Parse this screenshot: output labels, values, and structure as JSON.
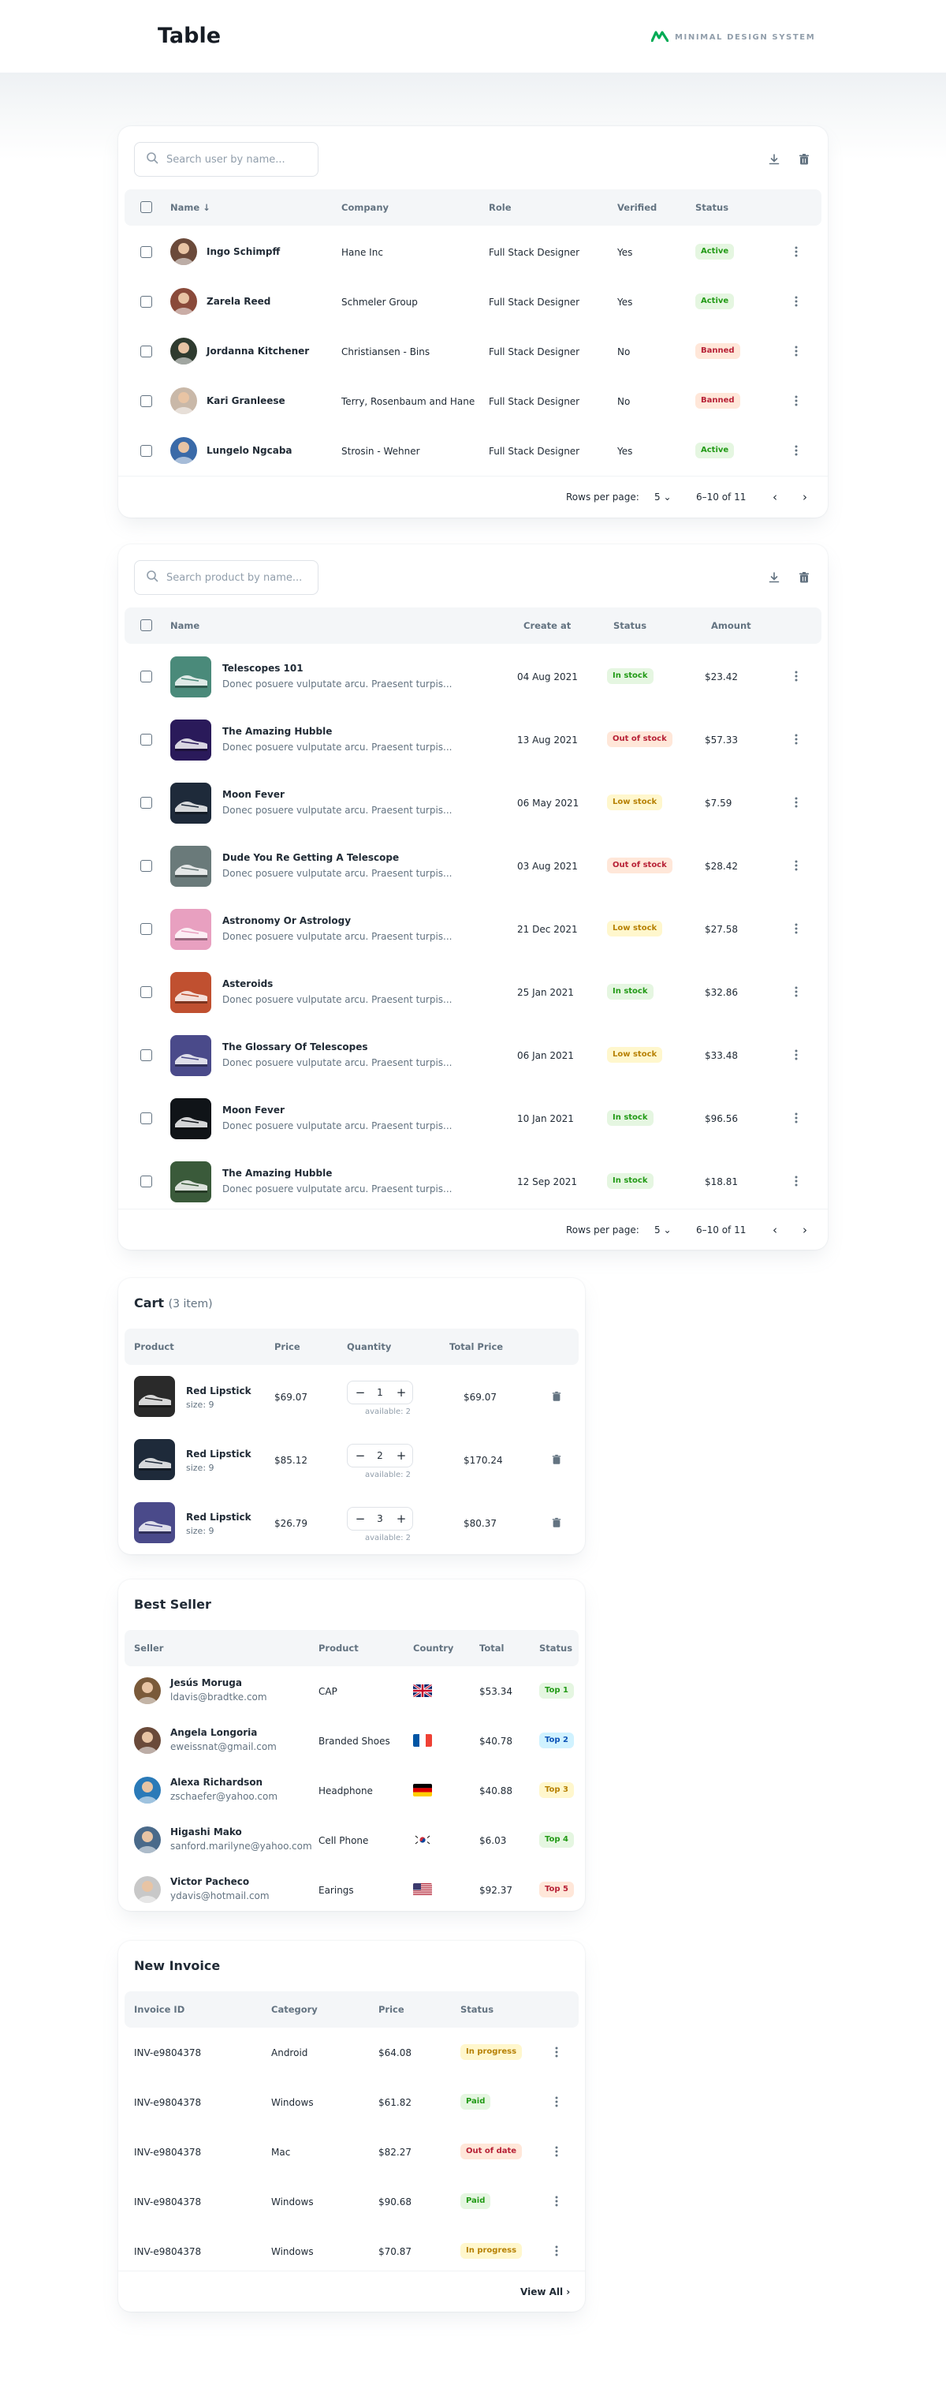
{
  "header": {
    "title": "Table",
    "brand": "MINIMAL DESIGN SYSTEM"
  },
  "users": {
    "search_placeholder": "Search user by name...",
    "columns": [
      "Name",
      "Company",
      "Role",
      "Verified",
      "Status"
    ],
    "rows": [
      {
        "name": "Ingo Schimpff",
        "company": "Hane Inc",
        "role": "Full Stack Designer",
        "verified": "Yes",
        "status": "Active",
        "avatar_color": "#6b4a3a"
      },
      {
        "name": "Zarela Reed",
        "company": "Schmeler Group",
        "role": "Full Stack Designer",
        "verified": "Yes",
        "status": "Active",
        "avatar_color": "#8a4a3a"
      },
      {
        "name": "Jordanna Kitchener",
        "company": "Christiansen - Bins",
        "role": "Full Stack Designer",
        "verified": "No",
        "status": "Banned",
        "avatar_color": "#2f3b2f"
      },
      {
        "name": "Kari Granleese",
        "company": "Terry, Rosenbaum and Hane",
        "role": "Full Stack Designer",
        "verified": "No",
        "status": "Banned",
        "avatar_color": "#c9b8a8"
      },
      {
        "name": "Lungelo Ngcaba",
        "company": "Strosin - Wehner",
        "role": "Full Stack Designer",
        "verified": "Yes",
        "status": "Active",
        "avatar_color": "#3a6aa8"
      }
    ],
    "pagination": {
      "rows_label": "Rows per page:",
      "rows_value": "5",
      "range": "6–10 of 11"
    }
  },
  "products": {
    "search_placeholder": "Search product by name...",
    "columns": [
      "Name",
      "Create at",
      "Status",
      "Amount"
    ],
    "rows": [
      {
        "name": "Telescopes 101",
        "desc": "Donec posuere vulputate arcu. Praesent turpis...",
        "created": "04 Aug 2021",
        "status": "In stock",
        "amount": "$23.42",
        "color": "#4a8a7a"
      },
      {
        "name": "The Amazing Hubble",
        "desc": "Donec posuere vulputate arcu. Praesent turpis...",
        "created": "13 Aug 2021",
        "status": "Out of stock",
        "amount": "$57.33",
        "color": "#2a1a5a"
      },
      {
        "name": "Moon Fever",
        "desc": "Donec posuere vulputate arcu. Praesent turpis...",
        "created": "06 May 2021",
        "status": "Low stock",
        "amount": "$7.59",
        "color": "#1e2a3a"
      },
      {
        "name": "Dude You Re Getting A Telescope",
        "desc": "Donec posuere vulputate arcu. Praesent turpis...",
        "created": "03 Aug 2021",
        "status": "Out of stock",
        "amount": "$28.42",
        "color": "#6a7a7a"
      },
      {
        "name": "Astronomy Or Astrology",
        "desc": "Donec posuere vulputate arcu. Praesent turpis...",
        "created": "21 Dec 2021",
        "status": "Low stock",
        "amount": "$27.58",
        "color": "#e8a0c0"
      },
      {
        "name": "Asteroids",
        "desc": "Donec posuere vulputate arcu. Praesent turpis...",
        "created": "25 Jan 2021",
        "status": "In stock",
        "amount": "$32.86",
        "color": "#c05030"
      },
      {
        "name": "The Glossary Of Telescopes",
        "desc": "Donec posuere vulputate arcu. Praesent turpis...",
        "created": "06 Jan 2021",
        "status": "Low stock",
        "amount": "$33.48",
        "color": "#4a4a8a"
      },
      {
        "name": "Moon Fever",
        "desc": "Donec posuere vulputate arcu. Praesent turpis...",
        "created": "10 Jan 2021",
        "status": "In stock",
        "amount": "$96.56",
        "color": "#101418"
      },
      {
        "name": "The Amazing Hubble",
        "desc": "Donec posuere vulputate arcu. Praesent turpis...",
        "created": "12 Sep 2021",
        "status": "In stock",
        "amount": "$18.81",
        "color": "#3a5a3a"
      }
    ],
    "pagination": {
      "rows_label": "Rows per page:",
      "rows_value": "5",
      "range": "6–10 of 11"
    }
  },
  "cart": {
    "title": "Cart",
    "count_label": "(3 item)",
    "columns": [
      "Product",
      "Price",
      "Quantity",
      "Total Price"
    ],
    "rows": [
      {
        "name": "Red Lipstick",
        "size": "size: 9",
        "price": "$69.07",
        "qty": "1",
        "available": "available: 2",
        "total": "$69.07",
        "color": "#2a2a2a"
      },
      {
        "name": "Red Lipstick",
        "size": "size: 9",
        "price": "$85.12",
        "qty": "2",
        "available": "available: 2",
        "total": "$170.24",
        "color": "#1e2a3a"
      },
      {
        "name": "Red Lipstick",
        "size": "size: 9",
        "price": "$26.79",
        "qty": "3",
        "available": "available: 2",
        "total": "$80.37",
        "color": "#4a4a8a"
      }
    ]
  },
  "best_seller": {
    "title": "Best Seller",
    "columns": [
      "Seller",
      "Product",
      "Country",
      "Total",
      "Status"
    ],
    "rows": [
      {
        "name": "Jesús Moruga",
        "email": "ldavis@bradtke.com",
        "product": "CAP",
        "flag": "gb",
        "total": "$53.34",
        "status": "Top 1",
        "avatar_color": "#7a5a3a"
      },
      {
        "name": "Angela Longoria",
        "email": "eweissnat@gmail.com",
        "product": "Branded Shoes",
        "flag": "fr",
        "total": "$40.78",
        "status": "Top 2",
        "avatar_color": "#6a4a3a"
      },
      {
        "name": "Alexa Richardson",
        "email": "zschaefer@yahoo.com",
        "product": "Headphone",
        "flag": "de",
        "total": "$40.88",
        "status": "Top 3",
        "avatar_color": "#2a7ab8"
      },
      {
        "name": "Higashi Mako",
        "email": "sanford.marilyne@yahoo.com",
        "product": "Cell Phone",
        "flag": "kr",
        "total": "$6.03",
        "status": "Top 4",
        "avatar_color": "#4a6a8a"
      },
      {
        "name": "Victor Pacheco",
        "email": "ydavis@hotmail.com",
        "product": "Earings",
        "flag": "us",
        "total": "$92.37",
        "status": "Top 5",
        "avatar_color": "#c8c8c8"
      }
    ]
  },
  "invoice": {
    "title": "New Invoice",
    "columns": [
      "Invoice ID",
      "Category",
      "Price",
      "Status"
    ],
    "rows": [
      {
        "id": "INV-e9804378",
        "category": "Android",
        "price": "$64.08",
        "status": "In progress"
      },
      {
        "id": "INV-e9804378",
        "category": "Windows",
        "price": "$61.82",
        "status": "Paid"
      },
      {
        "id": "INV-e9804378",
        "category": "Mac",
        "price": "$82.27",
        "status": "Out of date"
      },
      {
        "id": "INV-e9804378",
        "category": "Windows",
        "price": "$90.68",
        "status": "Paid"
      },
      {
        "id": "INV-e9804378",
        "category": "Windows",
        "price": "$70.87",
        "status": "In progress"
      }
    ],
    "view_all": "View All"
  },
  "status_colors": {
    "Active": {
      "bg": "#e5f6e1",
      "fg": "#229a16"
    },
    "Banned": {
      "bg": "#ffe7d9",
      "fg": "#b72136"
    },
    "In stock": {
      "bg": "#e5f6e1",
      "fg": "#229a16"
    },
    "Out of stock": {
      "bg": "#ffe7d9",
      "fg": "#b72136"
    },
    "Low stock": {
      "bg": "#fff7cd",
      "fg": "#b78103"
    },
    "Top 1": {
      "bg": "#e5f6e1",
      "fg": "#229a16"
    },
    "Top 2": {
      "bg": "#d0f2ff",
      "fg": "#0c53b7"
    },
    "Top 3": {
      "bg": "#fff7cd",
      "fg": "#b78103"
    },
    "Top 4": {
      "bg": "#e5f6e1",
      "fg": "#229a16"
    },
    "Top 5": {
      "bg": "#ffe7d9",
      "fg": "#b72136"
    },
    "In progress": {
      "bg": "#fff7cd",
      "fg": "#b78103"
    },
    "Paid": {
      "bg": "#e5f6e1",
      "fg": "#229a16"
    },
    "Out of date": {
      "bg": "#ffe7d9",
      "fg": "#b72136"
    }
  }
}
